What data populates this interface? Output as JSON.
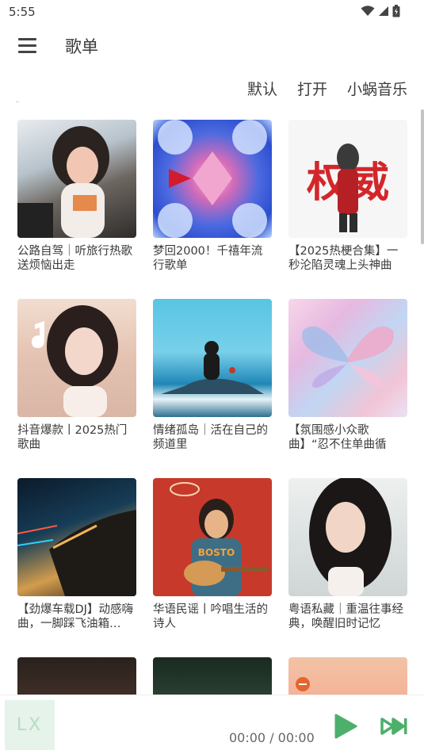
{
  "status": {
    "time": "5:55"
  },
  "header": {
    "title": "歌单"
  },
  "tabs": [
    {
      "label": "默认"
    },
    {
      "label": "打开"
    },
    {
      "label": "小蜗音乐"
    }
  ],
  "playlists": [
    {
      "title": "公路自驾｜听旅行热歌送烦恼出走"
    },
    {
      "title": "梦回2000！千禧年流行歌单"
    },
    {
      "title": "【2025热梗合集】一秒沦陷灵魂上头神曲",
      "cover_text": "权威"
    },
    {
      "title": "抖音爆款丨2025热门歌曲"
    },
    {
      "title": "情绪孤岛｜活在自己的频道里"
    },
    {
      "title": "【氛围感小众歌曲】“忍不住单曲循环！”"
    },
    {
      "title": "【劲爆车载DJ】动感嗨曲，一脚踩飞油箱…"
    },
    {
      "title": "华语民谣丨吟唱生活的诗人",
      "cover_text": "BOSTO"
    },
    {
      "title": "粤语私藏｜重温往事经典，唤醒旧时记忆"
    },
    {
      "title": ""
    },
    {
      "title": ""
    },
    {
      "title": ""
    }
  ],
  "player": {
    "logo": "LX",
    "time": "00:00 / 00:00",
    "accent_color": "#4caf6b"
  },
  "icons": {
    "menu": "menu-icon",
    "wifi": "wifi-icon",
    "signal": "signal-icon",
    "battery": "battery-icon",
    "play": "play-icon",
    "next": "skip-next-icon"
  }
}
